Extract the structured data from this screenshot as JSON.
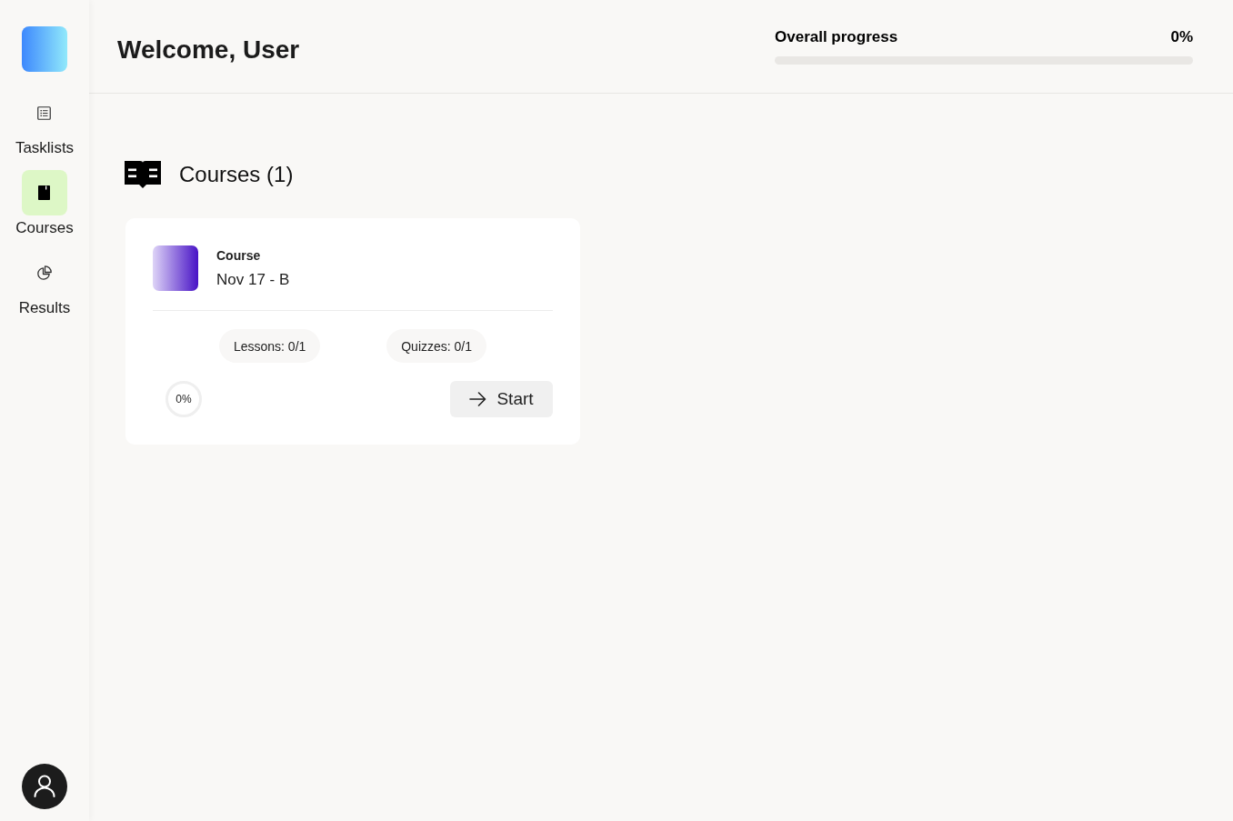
{
  "sidebar": {
    "items": [
      {
        "label": "Tasklists",
        "selected": false
      },
      {
        "label": "Courses",
        "selected": true
      },
      {
        "label": "Results",
        "selected": false
      }
    ]
  },
  "header": {
    "title": "Welcome, User",
    "progress": {
      "label": "Overall progress",
      "value": "0%"
    }
  },
  "courses": {
    "title": "Courses (1)",
    "items": [
      {
        "type_label": "Course",
        "name": "Nov 17 - B",
        "stats": [
          "Lessons: 0/1",
          "Quizzes: 0/1"
        ],
        "progress": "0%",
        "button": "Start"
      }
    ]
  }
}
